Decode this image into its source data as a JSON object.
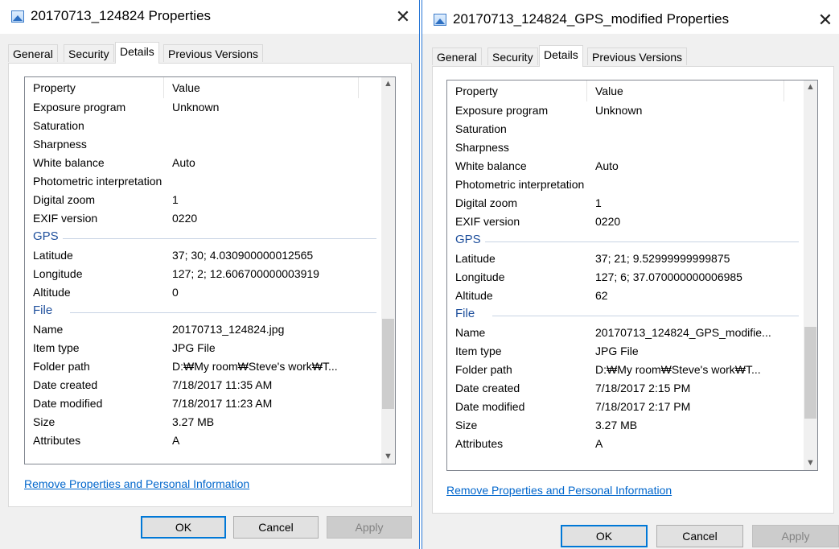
{
  "windows": [
    {
      "title": "20170713_124824 Properties",
      "close_glyph": "✕",
      "tabs": [
        {
          "label": "General",
          "active": false
        },
        {
          "label": "Security",
          "active": false
        },
        {
          "label": "Details",
          "active": true
        },
        {
          "label": "Previous Versions",
          "active": false
        }
      ],
      "header": {
        "property": "Property",
        "value": "Value"
      },
      "rows": [
        {
          "kind": "item",
          "property": "Exposure program",
          "value": "Unknown"
        },
        {
          "kind": "item",
          "property": "Saturation",
          "value": ""
        },
        {
          "kind": "item",
          "property": "Sharpness",
          "value": ""
        },
        {
          "kind": "item",
          "property": "White balance",
          "value": "Auto"
        },
        {
          "kind": "item",
          "property": "Photometric interpretation",
          "value": ""
        },
        {
          "kind": "item",
          "property": "Digital zoom",
          "value": "1"
        },
        {
          "kind": "item",
          "property": "EXIF version",
          "value": "0220"
        },
        {
          "kind": "group",
          "property": "GPS"
        },
        {
          "kind": "item",
          "property": "Latitude",
          "value": "37; 30; 4.030900000012565"
        },
        {
          "kind": "item",
          "property": "Longitude",
          "value": "127; 2; 12.606700000003919"
        },
        {
          "kind": "item",
          "property": "Altitude",
          "value": "0"
        },
        {
          "kind": "group",
          "property": "File"
        },
        {
          "kind": "item",
          "property": "Name",
          "value": "20170713_124824.jpg"
        },
        {
          "kind": "item",
          "property": "Item type",
          "value": "JPG File"
        },
        {
          "kind": "item",
          "property": "Folder path",
          "value": "D:₩My room₩Steve's work₩T..."
        },
        {
          "kind": "item",
          "property": "Date created",
          "value": "7/18/2017 11:35 AM"
        },
        {
          "kind": "item",
          "property": "Date modified",
          "value": "7/18/2017 11:23 AM"
        },
        {
          "kind": "item",
          "property": "Size",
          "value": "3.27 MB"
        },
        {
          "kind": "item",
          "property": "Attributes",
          "value": "A"
        }
      ],
      "remove_link": "Remove Properties and Personal Information",
      "buttons": {
        "ok": "OK",
        "cancel": "Cancel",
        "apply": "Apply"
      }
    },
    {
      "title": "20170713_124824_GPS_modified Properties",
      "close_glyph": "✕",
      "tabs": [
        {
          "label": "General",
          "active": false
        },
        {
          "label": "Security",
          "active": false
        },
        {
          "label": "Details",
          "active": true
        },
        {
          "label": "Previous Versions",
          "active": false
        }
      ],
      "header": {
        "property": "Property",
        "value": "Value"
      },
      "rows": [
        {
          "kind": "item",
          "property": "Exposure program",
          "value": "Unknown"
        },
        {
          "kind": "item",
          "property": "Saturation",
          "value": ""
        },
        {
          "kind": "item",
          "property": "Sharpness",
          "value": ""
        },
        {
          "kind": "item",
          "property": "White balance",
          "value": "Auto"
        },
        {
          "kind": "item",
          "property": "Photometric interpretation",
          "value": ""
        },
        {
          "kind": "item",
          "property": "Digital zoom",
          "value": "1"
        },
        {
          "kind": "item",
          "property": "EXIF version",
          "value": "0220"
        },
        {
          "kind": "group",
          "property": "GPS"
        },
        {
          "kind": "item",
          "property": "Latitude",
          "value": "37; 21; 9.52999999999875"
        },
        {
          "kind": "item",
          "property": "Longitude",
          "value": "127; 6; 37.070000000006985"
        },
        {
          "kind": "item",
          "property": "Altitude",
          "value": "62"
        },
        {
          "kind": "group",
          "property": "File"
        },
        {
          "kind": "item",
          "property": "Name",
          "value": "20170713_124824_GPS_modifie..."
        },
        {
          "kind": "item",
          "property": "Item type",
          "value": "JPG File"
        },
        {
          "kind": "item",
          "property": "Folder path",
          "value": "D:₩My room₩Steve's work₩T..."
        },
        {
          "kind": "item",
          "property": "Date created",
          "value": "7/18/2017 2:15 PM"
        },
        {
          "kind": "item",
          "property": "Date modified",
          "value": "7/18/2017 2:17 PM"
        },
        {
          "kind": "item",
          "property": "Size",
          "value": "3.27 MB"
        },
        {
          "kind": "item",
          "property": "Attributes",
          "value": "A"
        }
      ],
      "remove_link": "Remove Properties and Personal Information",
      "buttons": {
        "ok": "OK",
        "cancel": "Cancel",
        "apply": "Apply"
      }
    }
  ],
  "colors": {
    "accent": "#0078d7",
    "group_header": "#1e4f9c",
    "link": "#0066cc"
  }
}
